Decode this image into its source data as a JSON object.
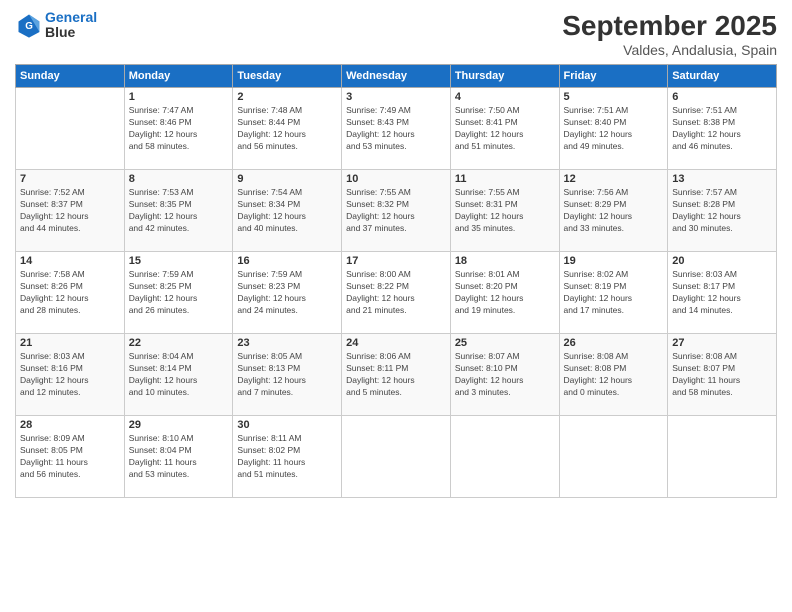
{
  "header": {
    "logo_line1": "General",
    "logo_line2": "Blue",
    "month": "September 2025",
    "location": "Valdes, Andalusia, Spain"
  },
  "weekdays": [
    "Sunday",
    "Monday",
    "Tuesday",
    "Wednesday",
    "Thursday",
    "Friday",
    "Saturday"
  ],
  "weeks": [
    [
      {
        "day": "",
        "info": ""
      },
      {
        "day": "1",
        "info": "Sunrise: 7:47 AM\nSunset: 8:46 PM\nDaylight: 12 hours\nand 58 minutes."
      },
      {
        "day": "2",
        "info": "Sunrise: 7:48 AM\nSunset: 8:44 PM\nDaylight: 12 hours\nand 56 minutes."
      },
      {
        "day": "3",
        "info": "Sunrise: 7:49 AM\nSunset: 8:43 PM\nDaylight: 12 hours\nand 53 minutes."
      },
      {
        "day": "4",
        "info": "Sunrise: 7:50 AM\nSunset: 8:41 PM\nDaylight: 12 hours\nand 51 minutes."
      },
      {
        "day": "5",
        "info": "Sunrise: 7:51 AM\nSunset: 8:40 PM\nDaylight: 12 hours\nand 49 minutes."
      },
      {
        "day": "6",
        "info": "Sunrise: 7:51 AM\nSunset: 8:38 PM\nDaylight: 12 hours\nand 46 minutes."
      }
    ],
    [
      {
        "day": "7",
        "info": "Sunrise: 7:52 AM\nSunset: 8:37 PM\nDaylight: 12 hours\nand 44 minutes."
      },
      {
        "day": "8",
        "info": "Sunrise: 7:53 AM\nSunset: 8:35 PM\nDaylight: 12 hours\nand 42 minutes."
      },
      {
        "day": "9",
        "info": "Sunrise: 7:54 AM\nSunset: 8:34 PM\nDaylight: 12 hours\nand 40 minutes."
      },
      {
        "day": "10",
        "info": "Sunrise: 7:55 AM\nSunset: 8:32 PM\nDaylight: 12 hours\nand 37 minutes."
      },
      {
        "day": "11",
        "info": "Sunrise: 7:55 AM\nSunset: 8:31 PM\nDaylight: 12 hours\nand 35 minutes."
      },
      {
        "day": "12",
        "info": "Sunrise: 7:56 AM\nSunset: 8:29 PM\nDaylight: 12 hours\nand 33 minutes."
      },
      {
        "day": "13",
        "info": "Sunrise: 7:57 AM\nSunset: 8:28 PM\nDaylight: 12 hours\nand 30 minutes."
      }
    ],
    [
      {
        "day": "14",
        "info": "Sunrise: 7:58 AM\nSunset: 8:26 PM\nDaylight: 12 hours\nand 28 minutes."
      },
      {
        "day": "15",
        "info": "Sunrise: 7:59 AM\nSunset: 8:25 PM\nDaylight: 12 hours\nand 26 minutes."
      },
      {
        "day": "16",
        "info": "Sunrise: 7:59 AM\nSunset: 8:23 PM\nDaylight: 12 hours\nand 24 minutes."
      },
      {
        "day": "17",
        "info": "Sunrise: 8:00 AM\nSunset: 8:22 PM\nDaylight: 12 hours\nand 21 minutes."
      },
      {
        "day": "18",
        "info": "Sunrise: 8:01 AM\nSunset: 8:20 PM\nDaylight: 12 hours\nand 19 minutes."
      },
      {
        "day": "19",
        "info": "Sunrise: 8:02 AM\nSunset: 8:19 PM\nDaylight: 12 hours\nand 17 minutes."
      },
      {
        "day": "20",
        "info": "Sunrise: 8:03 AM\nSunset: 8:17 PM\nDaylight: 12 hours\nand 14 minutes."
      }
    ],
    [
      {
        "day": "21",
        "info": "Sunrise: 8:03 AM\nSunset: 8:16 PM\nDaylight: 12 hours\nand 12 minutes."
      },
      {
        "day": "22",
        "info": "Sunrise: 8:04 AM\nSunset: 8:14 PM\nDaylight: 12 hours\nand 10 minutes."
      },
      {
        "day": "23",
        "info": "Sunrise: 8:05 AM\nSunset: 8:13 PM\nDaylight: 12 hours\nand 7 minutes."
      },
      {
        "day": "24",
        "info": "Sunrise: 8:06 AM\nSunset: 8:11 PM\nDaylight: 12 hours\nand 5 minutes."
      },
      {
        "day": "25",
        "info": "Sunrise: 8:07 AM\nSunset: 8:10 PM\nDaylight: 12 hours\nand 3 minutes."
      },
      {
        "day": "26",
        "info": "Sunrise: 8:08 AM\nSunset: 8:08 PM\nDaylight: 12 hours\nand 0 minutes."
      },
      {
        "day": "27",
        "info": "Sunrise: 8:08 AM\nSunset: 8:07 PM\nDaylight: 11 hours\nand 58 minutes."
      }
    ],
    [
      {
        "day": "28",
        "info": "Sunrise: 8:09 AM\nSunset: 8:05 PM\nDaylight: 11 hours\nand 56 minutes."
      },
      {
        "day": "29",
        "info": "Sunrise: 8:10 AM\nSunset: 8:04 PM\nDaylight: 11 hours\nand 53 minutes."
      },
      {
        "day": "30",
        "info": "Sunrise: 8:11 AM\nSunset: 8:02 PM\nDaylight: 11 hours\nand 51 minutes."
      },
      {
        "day": "",
        "info": ""
      },
      {
        "day": "",
        "info": ""
      },
      {
        "day": "",
        "info": ""
      },
      {
        "day": "",
        "info": ""
      }
    ]
  ]
}
